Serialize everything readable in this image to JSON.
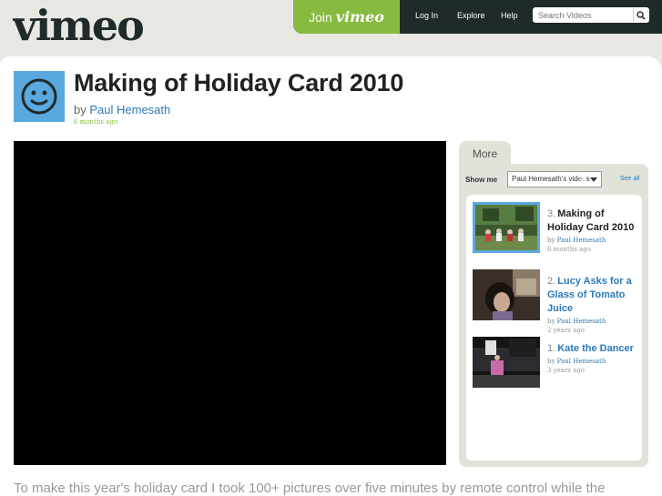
{
  "header": {
    "logo_text": "vimeo",
    "join_label": "Join",
    "join_logo": "vimeo",
    "nav": {
      "login": "Log In",
      "explore": "Explore",
      "help": "Help"
    },
    "search_placeholder": "Search Videos"
  },
  "video": {
    "title": "Making of Holiday Card 2010",
    "by_prefix": "by",
    "author": "Paul Hemesath",
    "ago": "6 months ago",
    "description": "To make this year's holiday card I took 100+ pictures over five minutes by remote control while the"
  },
  "sidebar": {
    "tab_label": "More",
    "show_me_label": "Show me",
    "show_me_value": "Paul Hemesath's videos",
    "see_all": "See all",
    "items": [
      {
        "num": "3.",
        "title": "Making of Holiday Card 2010",
        "by": "by",
        "author": "Paul Hemesath",
        "ago": "6 months ago"
      },
      {
        "num": "2.",
        "title": "Lucy Asks for a Glass of Tomato Juice",
        "by": "by",
        "author": "Paul Hemesath",
        "ago": "2 years ago"
      },
      {
        "num": "1.",
        "title": "Kate the Dancer",
        "by": "by",
        "author": "Paul Hemesath",
        "ago": "3 years ago"
      }
    ]
  },
  "colors": {
    "accent_green": "#86bb3f",
    "link_blue": "#2a7ab8",
    "topbar": "#1f2a2a",
    "avatar_blue": "#5aa8e0"
  }
}
